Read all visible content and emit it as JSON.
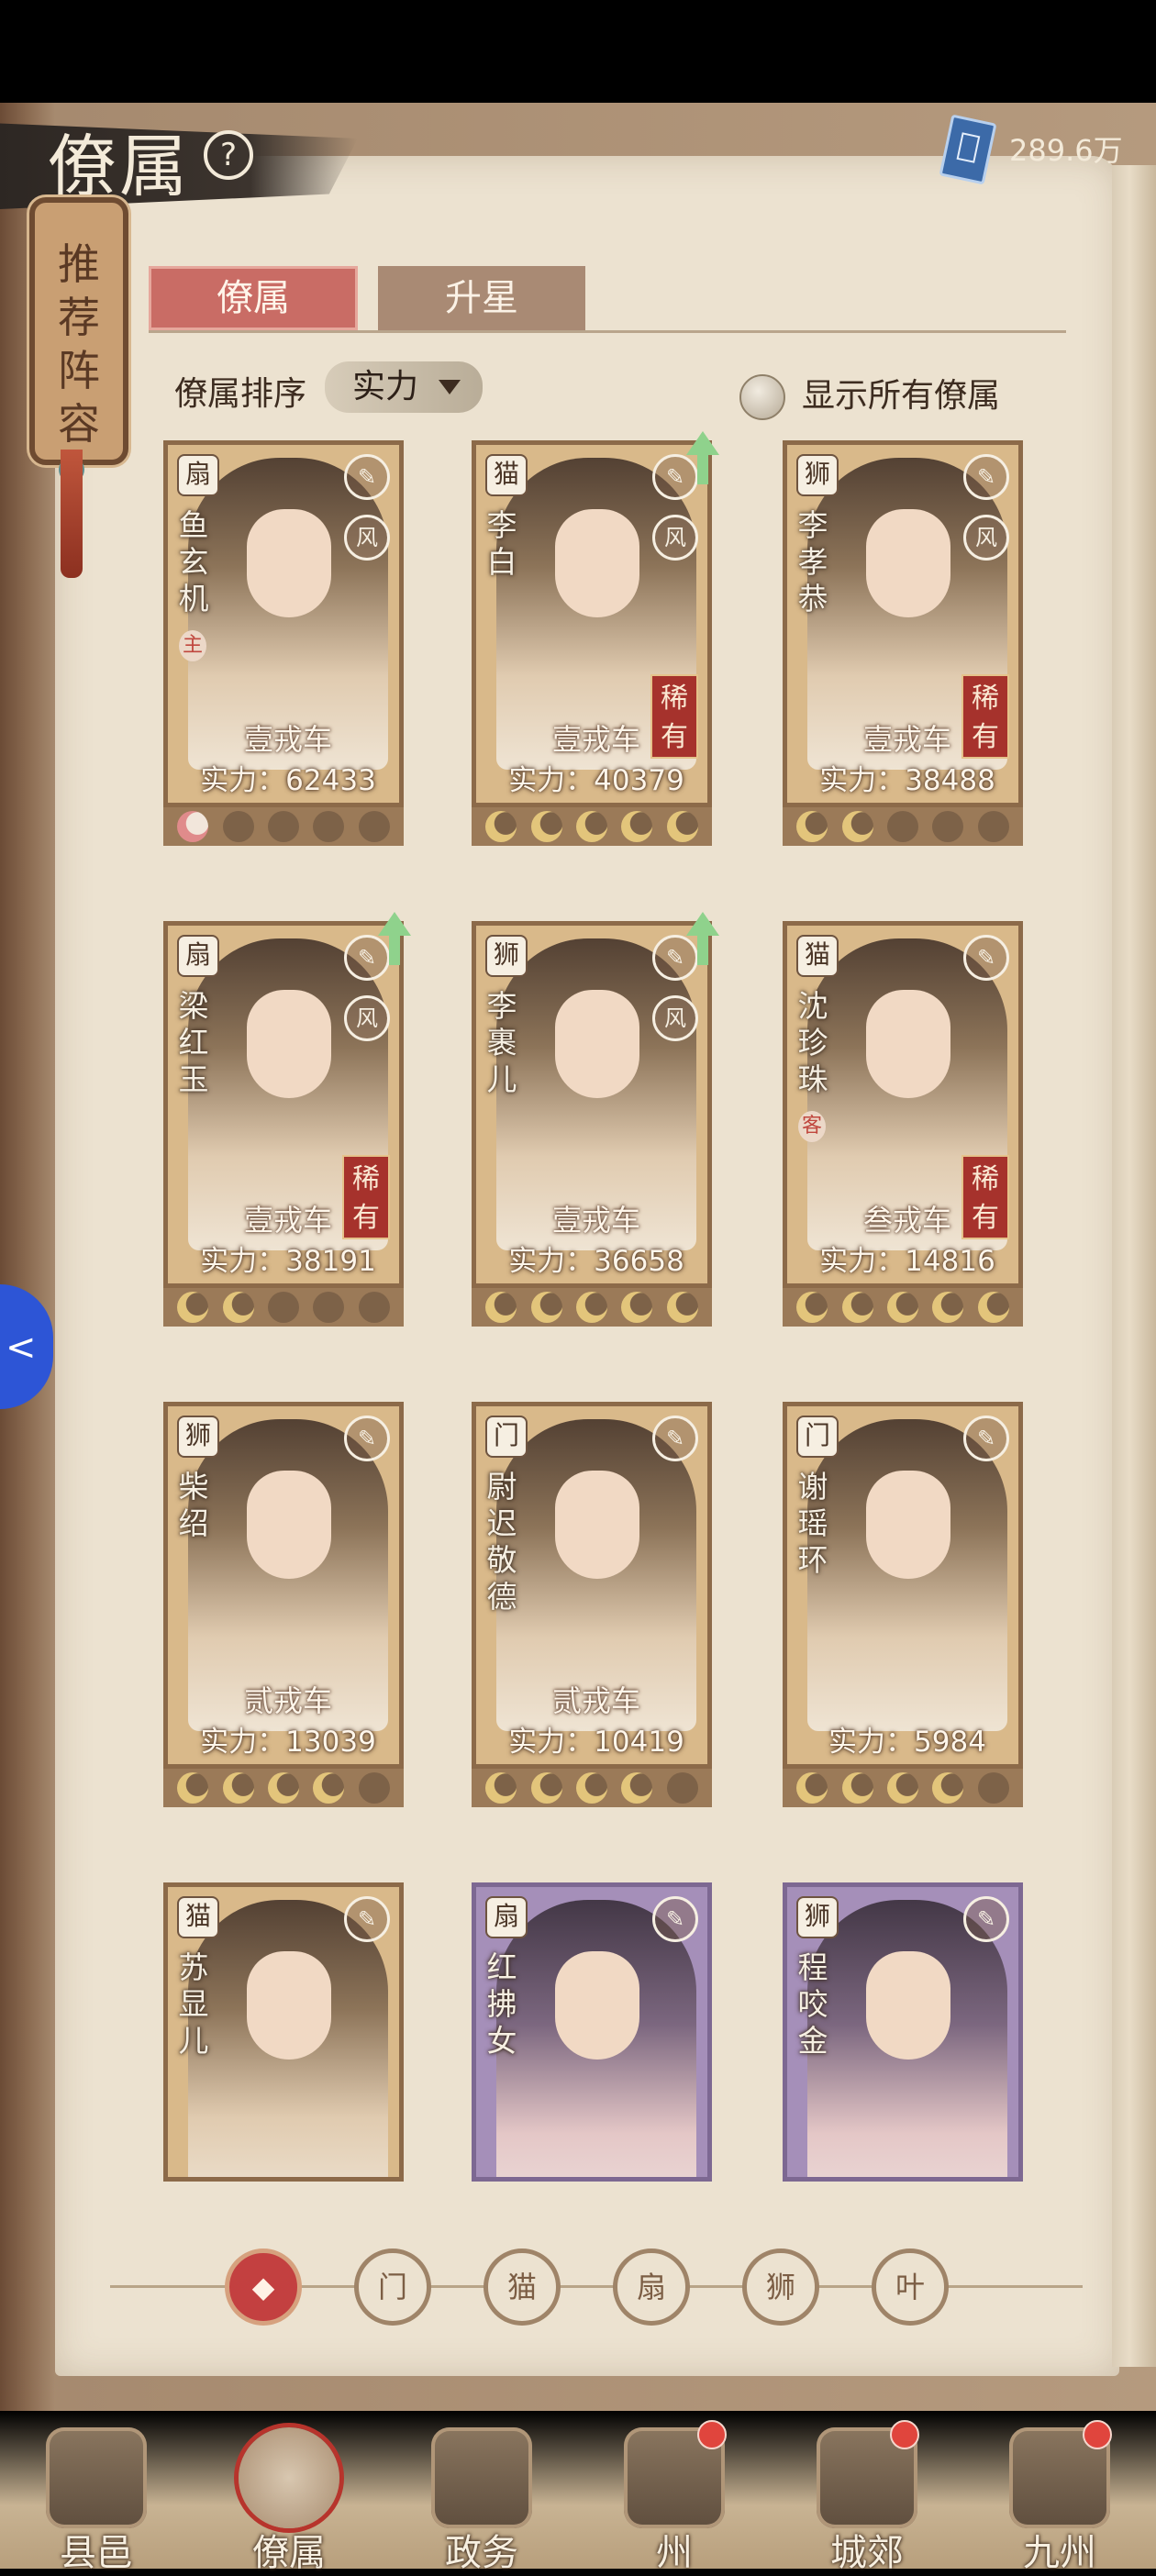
{
  "header": {
    "title": "僚属",
    "currency_value": "289.6万"
  },
  "banner": {
    "label": "推荐阵容"
  },
  "tabs": [
    {
      "label": "僚属",
      "active": true
    },
    {
      "label": "升星",
      "active": false
    }
  ],
  "sort": {
    "label": "僚属排序",
    "value": "实力"
  },
  "show_all": {
    "label": "显示所有僚属",
    "checked": false
  },
  "cards": [
    {
      "name": "鱼玄机",
      "tag": "主",
      "rarity": "",
      "level": "壹戎车",
      "power": "实力：62433",
      "stars_lit": 1,
      "star_color": "pink",
      "upgrade": false,
      "class_icon": "fan-icon",
      "element": "风",
      "variant": "gold"
    },
    {
      "name": "李白",
      "tag": "",
      "rarity": "稀有",
      "level": "壹戎车",
      "power": "实力：40379",
      "stars_lit": 5,
      "star_color": "gold",
      "upgrade": true,
      "class_icon": "cat-icon",
      "element": "风",
      "variant": "gold"
    },
    {
      "name": "李孝恭",
      "tag": "",
      "rarity": "稀有",
      "level": "壹戎车",
      "power": "实力：38488",
      "stars_lit": 2,
      "star_color": "gold",
      "upgrade": false,
      "class_icon": "lion-icon",
      "element": "风",
      "variant": "gold"
    },
    {
      "name": "梁红玉",
      "tag": "",
      "rarity": "稀有",
      "level": "壹戎车",
      "power": "实力：38191",
      "stars_lit": 2,
      "star_color": "gold",
      "upgrade": true,
      "class_icon": "fan-icon",
      "element": "风",
      "variant": "gold"
    },
    {
      "name": "李裹儿",
      "tag": "",
      "rarity": "",
      "level": "壹戎车",
      "power": "实力：36658",
      "stars_lit": 5,
      "star_color": "gold",
      "upgrade": true,
      "class_icon": "lion-icon",
      "element": "风",
      "variant": "gold"
    },
    {
      "name": "沈珍珠",
      "tag": "客",
      "rarity": "稀有",
      "level": "叁戎车",
      "power": "实力：14816",
      "stars_lit": 5,
      "star_color": "gold",
      "upgrade": false,
      "class_icon": "cat-icon",
      "element": "",
      "variant": "gold"
    },
    {
      "name": "柴绍",
      "tag": "",
      "rarity": "",
      "level": "贰戎车",
      "power": "实力：13039",
      "stars_lit": 4,
      "star_color": "gold",
      "upgrade": false,
      "class_icon": "lion-icon",
      "element": "",
      "variant": "gold"
    },
    {
      "name": "尉迟敬德",
      "tag": "",
      "rarity": "",
      "level": "贰戎车",
      "power": "实力：10419",
      "stars_lit": 4,
      "star_color": "gold",
      "upgrade": false,
      "class_icon": "gate-icon",
      "element": "",
      "variant": "gold"
    },
    {
      "name": "谢瑶环",
      "tag": "",
      "rarity": "",
      "level": "",
      "power": "实力：5984",
      "stars_lit": 4,
      "star_color": "gold",
      "upgrade": false,
      "class_icon": "gate-icon",
      "element": "",
      "variant": "gold"
    },
    {
      "name": "苏显儿",
      "tag": "",
      "rarity": "",
      "level": "",
      "power": "",
      "stars_lit": 0,
      "star_color": "gold",
      "upgrade": false,
      "class_icon": "cat-icon",
      "element": "",
      "variant": "gold"
    },
    {
      "name": "红拂女",
      "tag": "",
      "rarity": "",
      "level": "",
      "power": "",
      "stars_lit": 0,
      "star_color": "gold",
      "upgrade": false,
      "class_icon": "fan-icon",
      "element": "",
      "variant": "purple"
    },
    {
      "name": "程咬金",
      "tag": "",
      "rarity": "",
      "level": "",
      "power": "",
      "stars_lit": 0,
      "star_color": "gold",
      "upgrade": false,
      "class_icon": "lion-icon",
      "element": "",
      "variant": "purple"
    }
  ],
  "filters": [
    {
      "name": "all-filter",
      "active": true
    },
    {
      "name": "gate-filter",
      "active": false
    },
    {
      "name": "cat-filter",
      "active": false
    },
    {
      "name": "fan-filter",
      "active": false
    },
    {
      "name": "lion-filter",
      "active": false
    },
    {
      "name": "leaf-filter",
      "active": false
    }
  ],
  "nav": [
    {
      "label": "县邑",
      "active": false,
      "badge": false
    },
    {
      "label": "僚属",
      "active": true,
      "badge": false
    },
    {
      "label": "政务",
      "active": false,
      "badge": false
    },
    {
      "label": "州",
      "active": false,
      "badge": true
    },
    {
      "label": "城郊",
      "active": false,
      "badge": true
    },
    {
      "label": "九州",
      "active": false,
      "badge": true
    }
  ],
  "colors": {
    "accent": "#c96c65",
    "rarity": "#a6322c",
    "side_toggle": "#2d55d6"
  }
}
